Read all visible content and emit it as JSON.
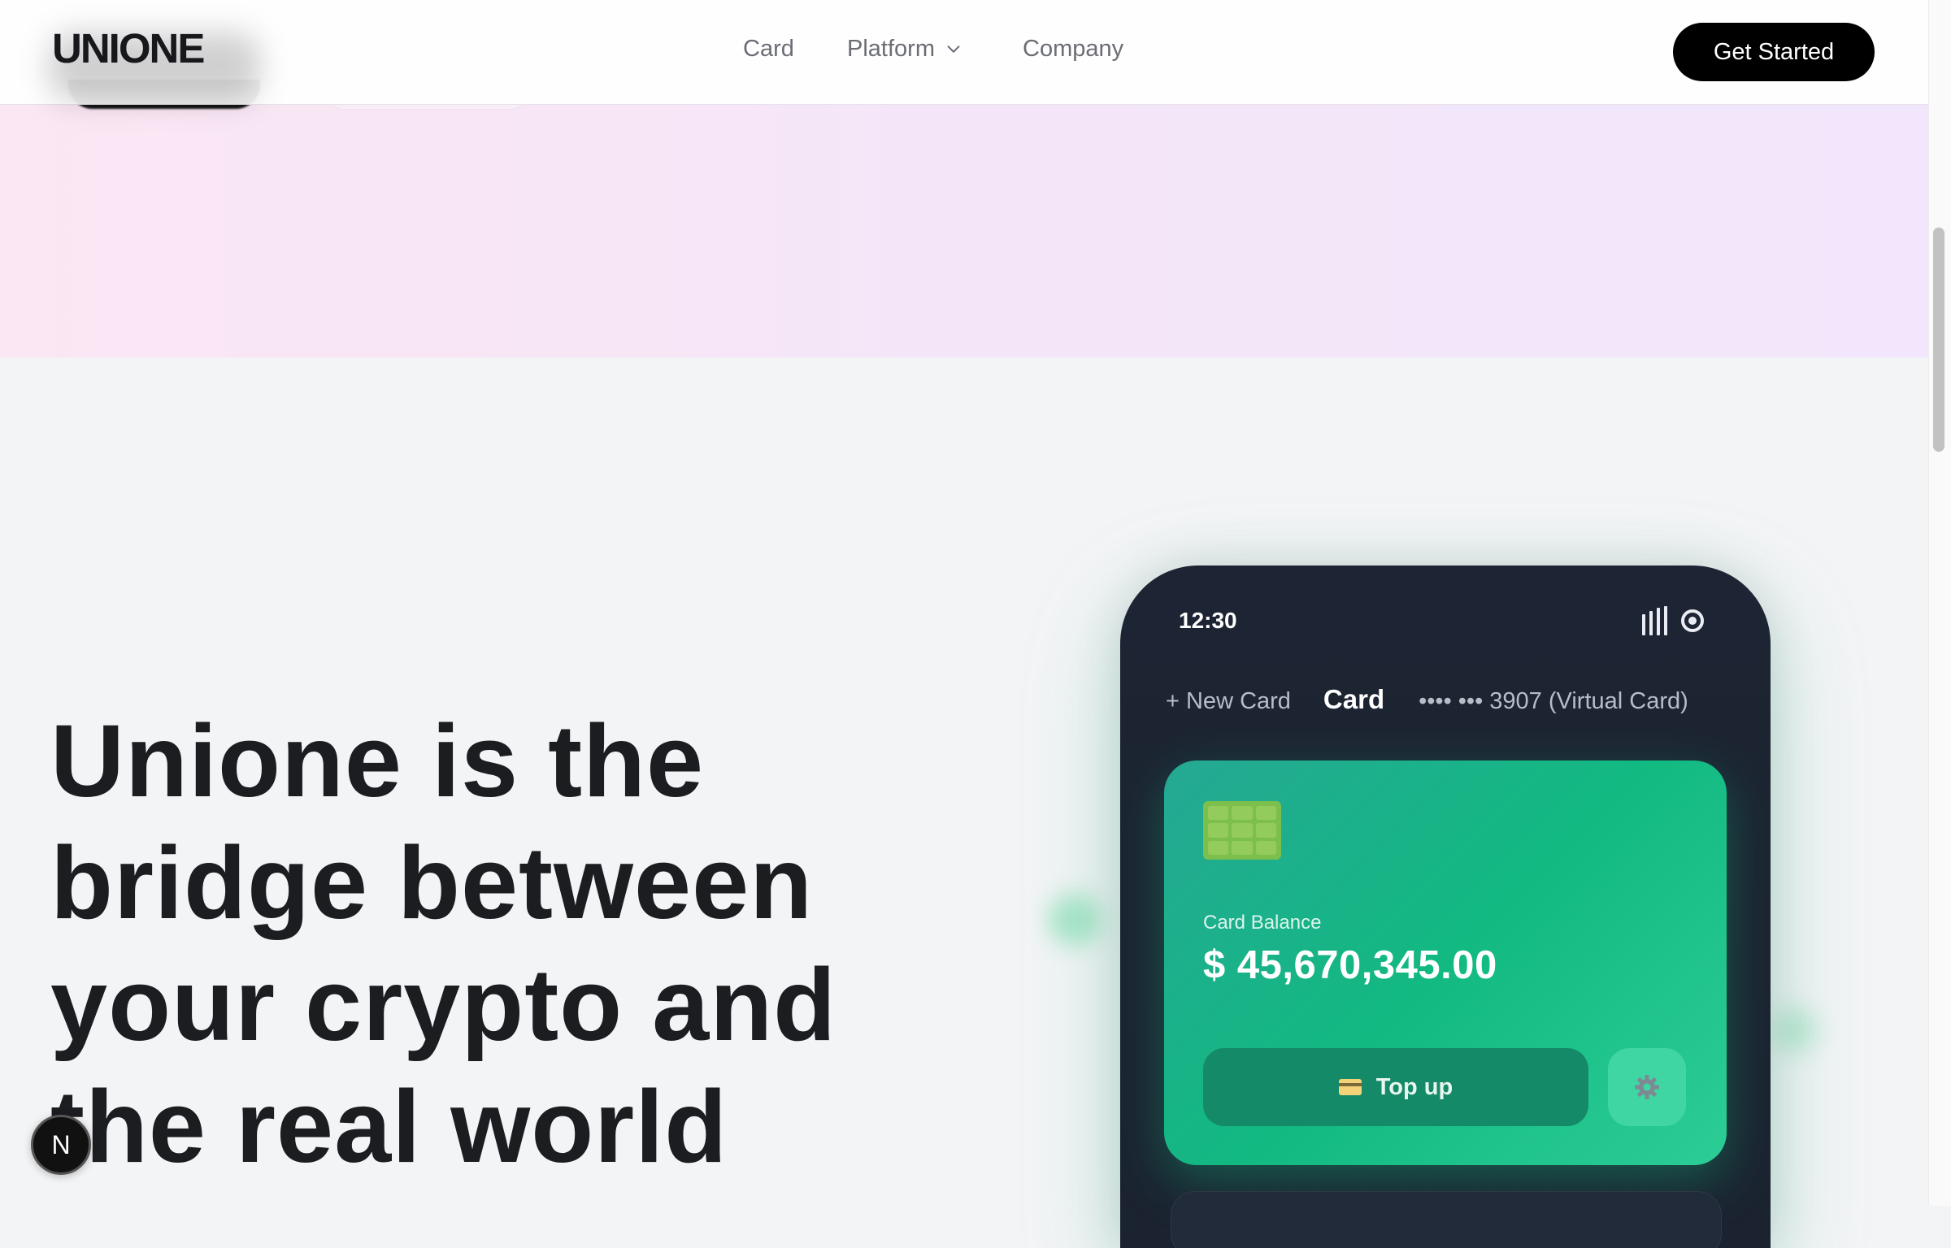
{
  "header": {
    "logo": "UNIONE",
    "nav": {
      "card": "Card",
      "platform": "Platform",
      "company": "Company"
    },
    "cta": "Get Started"
  },
  "hero": {
    "title": "Unione is the bridge between your crypto and the real world"
  },
  "phone": {
    "time": "12:30",
    "tabs": {
      "new_card": "+ New Card",
      "card": "Card",
      "virtual": "•••• ••• 3907 (Virtual Card)"
    },
    "card": {
      "balance_label": "Card Balance",
      "balance_value": "$ 45,670,345.00",
      "topup_label": "Top up"
    }
  },
  "badge": "N",
  "colors": {
    "accent_green": "#12b981",
    "cta_bg": "#000000",
    "phone_bg": "#1d2433"
  },
  "icons": [
    "chevron-down-icon",
    "signal-bars-icon",
    "record-icon",
    "card-chip-icon",
    "credit-card-icon",
    "gear-icon"
  ]
}
